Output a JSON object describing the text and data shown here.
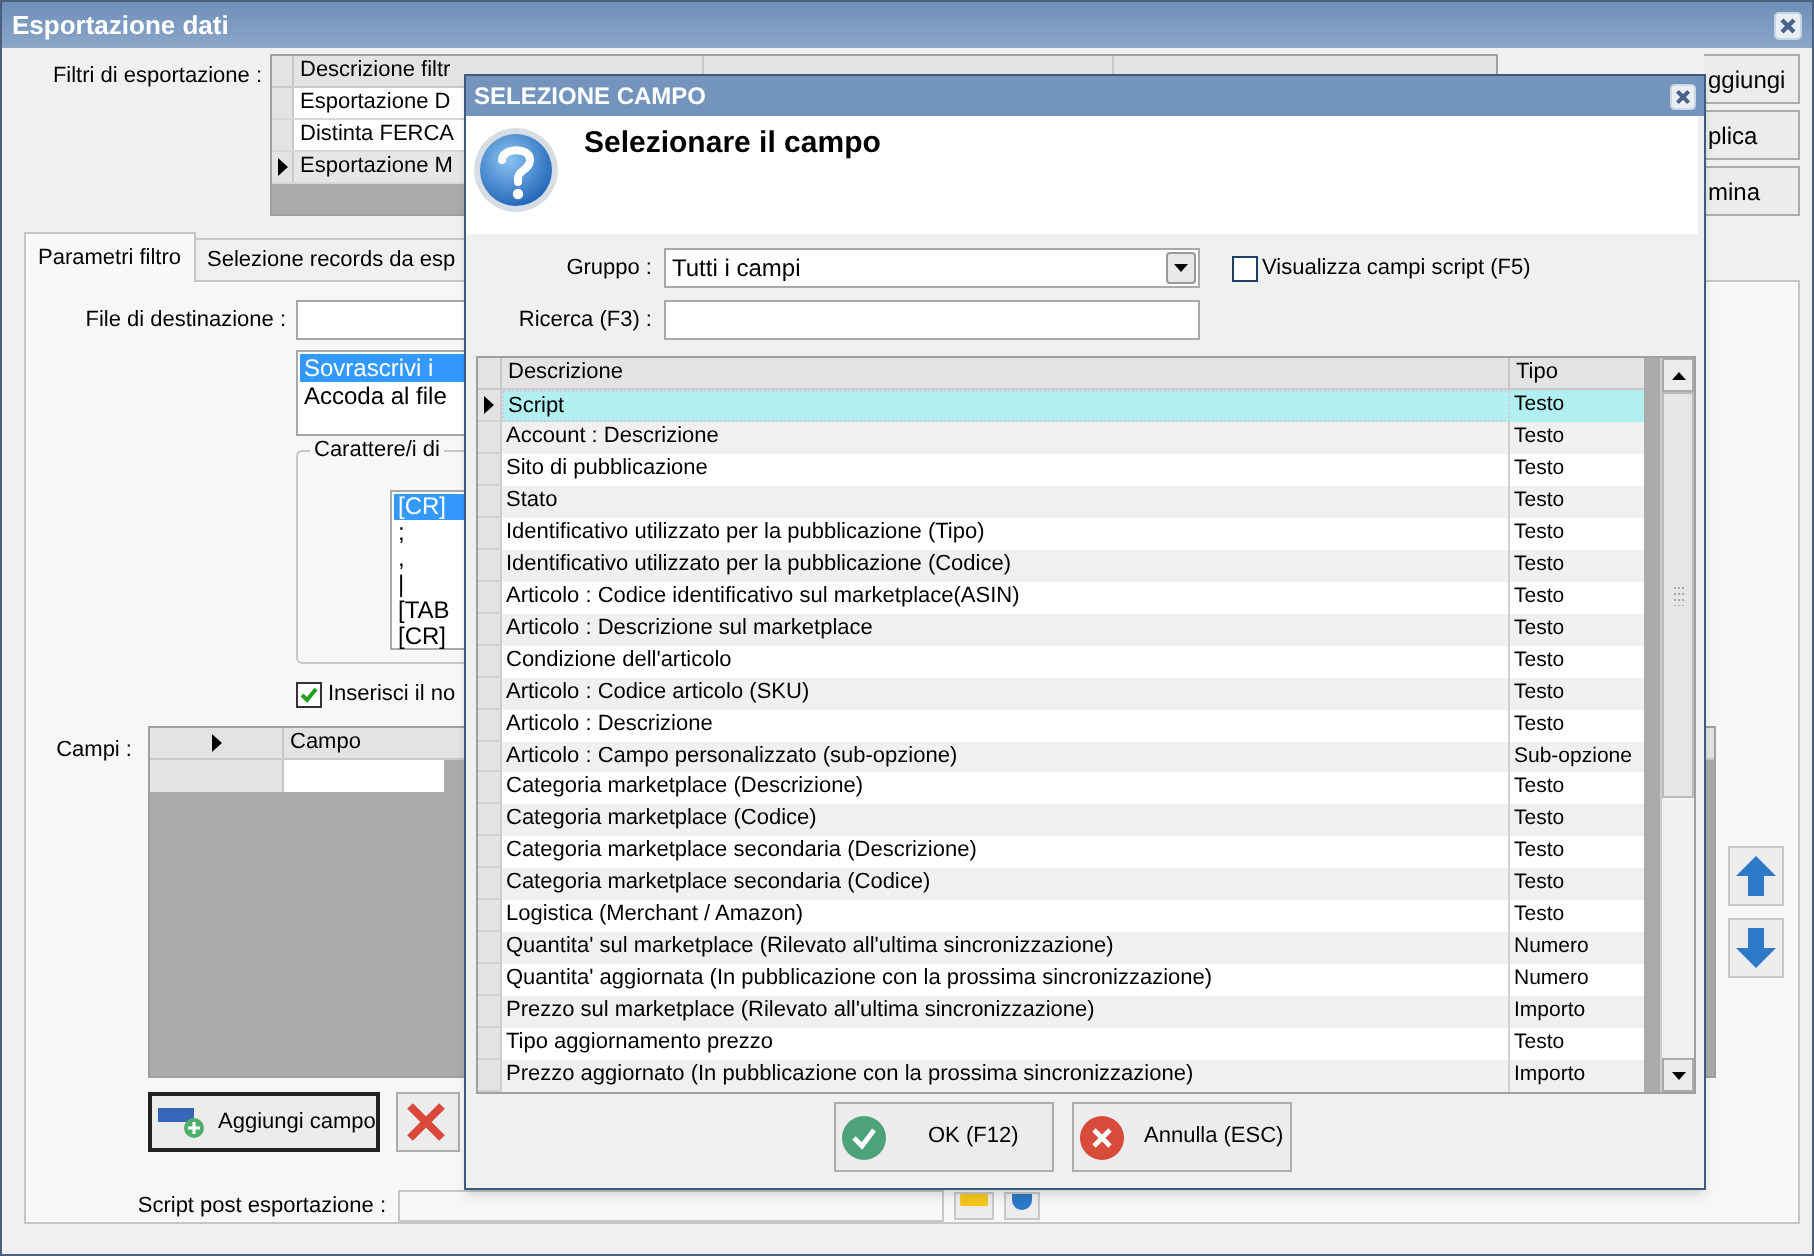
{
  "window": {
    "title": "Esportazione dati"
  },
  "filters": {
    "label": "Filtri di esportazione :",
    "header": "Descrizione filtr",
    "rows": [
      {
        "text": "Esportazione D",
        "selected": false
      },
      {
        "text": "Distinta FERCA",
        "selected": false
      },
      {
        "text": "Esportazione M",
        "selected": true
      }
    ]
  },
  "side_buttons": [
    "ggiungi",
    "plica",
    "mina"
  ],
  "tabs": [
    {
      "label": "Parametri filtro",
      "selected": true
    },
    {
      "label": "Selezione records da esp",
      "selected": false
    }
  ],
  "destination": {
    "label": "File di destinazione :",
    "modes": [
      {
        "text": "Sovrascrivi i",
        "selected": true
      },
      {
        "text": "Accoda al file",
        "selected": false
      }
    ]
  },
  "separators": {
    "legend": "Carattere/i di",
    "items": [
      {
        "text": "[CR]",
        "selected": true
      },
      {
        "text": ";",
        "selected": false
      },
      {
        "text": ",",
        "selected": false
      },
      {
        "text": "|",
        "selected": false
      },
      {
        "text": "[TAB",
        "selected": false
      },
      {
        "text": "[CR]",
        "selected": false
      }
    ]
  },
  "header_checkbox": {
    "label": "Inserisci il no",
    "checked": true
  },
  "fields_grid": {
    "label": "Campi :",
    "column": "Campo"
  },
  "add_field_button": "Aggiungi campo",
  "script_post": {
    "label": "Script post esportazione :"
  },
  "dialog": {
    "title": "SELEZIONE CAMPO",
    "heading": "Selezionare il campo",
    "group": {
      "label": "Gruppo :",
      "value": "Tutti i campi"
    },
    "script_checkbox": {
      "label": "Visualizza campi script (F5)",
      "checked": false
    },
    "search": {
      "label": "Ricerca (F3) :"
    },
    "columns": [
      "Descrizione",
      "Tipo"
    ],
    "rows": [
      {
        "description": "Script",
        "type": "Testo",
        "selected": true
      },
      {
        "description": "Account : Descrizione",
        "type": "Testo",
        "selected": false
      },
      {
        "description": "Sito di pubblicazione",
        "type": "Testo",
        "selected": false
      },
      {
        "description": "Stato",
        "type": "Testo",
        "selected": false
      },
      {
        "description": "Identificativo utilizzato per la pubblicazione (Tipo)",
        "type": "Testo",
        "selected": false
      },
      {
        "description": "Identificativo utilizzato per la pubblicazione (Codice)",
        "type": "Testo",
        "selected": false
      },
      {
        "description": "Articolo : Codice identificativo sul marketplace(ASIN)",
        "type": "Testo",
        "selected": false
      },
      {
        "description": "Articolo : Descrizione sul marketplace",
        "type": "Testo",
        "selected": false
      },
      {
        "description": "Condizione dell'articolo",
        "type": "Testo",
        "selected": false
      },
      {
        "description": "Articolo : Codice articolo (SKU)",
        "type": "Testo",
        "selected": false
      },
      {
        "description": "Articolo : Descrizione",
        "type": "Testo",
        "selected": false
      },
      {
        "description": "Articolo : Campo personalizzato (sub-opzione)",
        "type": "Sub-opzione",
        "selected": false
      },
      {
        "description": "Categoria marketplace (Descrizione)",
        "type": "Testo",
        "selected": false
      },
      {
        "description": "Categoria marketplace (Codice)",
        "type": "Testo",
        "selected": false
      },
      {
        "description": "Categoria marketplace secondaria (Descrizione)",
        "type": "Testo",
        "selected": false
      },
      {
        "description": "Categoria marketplace secondaria (Codice)",
        "type": "Testo",
        "selected": false
      },
      {
        "description": "Logistica (Merchant / Amazon)",
        "type": "Testo",
        "selected": false
      },
      {
        "description": "Quantita' sul marketplace (Rilevato all'ultima sincronizzazione)",
        "type": "Numero",
        "selected": false
      },
      {
        "description": "Quantita' aggiornata (In pubblicazione con la prossima sincronizzazione)",
        "type": "Numero",
        "selected": false
      },
      {
        "description": "Prezzo sul marketplace (Rilevato all'ultima sincronizzazione)",
        "type": "Importo",
        "selected": false
      },
      {
        "description": "Tipo aggiornamento prezzo",
        "type": "Testo",
        "selected": false
      },
      {
        "description": "Prezzo aggiornato (In pubblicazione con la prossima sincronizzazione)",
        "type": "Importo",
        "selected": false
      }
    ],
    "ok_button": "OK (F12)",
    "cancel_button": "Annulla (ESC)"
  }
}
